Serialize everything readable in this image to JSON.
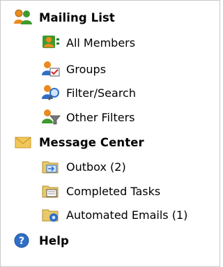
{
  "nav": {
    "sections": [
      {
        "title": "Mailing List",
        "icon": "users-icon",
        "items": [
          {
            "label": "All Members",
            "icon": "members-icon"
          },
          {
            "label": "Groups",
            "icon": "groups-icon"
          },
          {
            "label": "Filter/Search",
            "icon": "filter-search-icon"
          },
          {
            "label": "Other Filters",
            "icon": "funnel-filter-icon"
          }
        ]
      },
      {
        "title": "Message Center",
        "icon": "envelope-icon",
        "items": [
          {
            "label": "Outbox (2)",
            "icon": "outbox-folder-icon"
          },
          {
            "label": "Completed Tasks",
            "icon": "completed-folder-icon"
          },
          {
            "label": "Automated Emails (1)",
            "icon": "automated-folder-icon"
          }
        ]
      },
      {
        "title": "Help",
        "icon": "help-icon",
        "items": []
      }
    ]
  },
  "colors": {
    "border": "#c9c9c9",
    "people_green": "#3f9a2e",
    "people_orange": "#e98b1e",
    "envelope": "#f2c75a",
    "folder": "#e8c96a",
    "help_blue": "#2f6fc8"
  }
}
